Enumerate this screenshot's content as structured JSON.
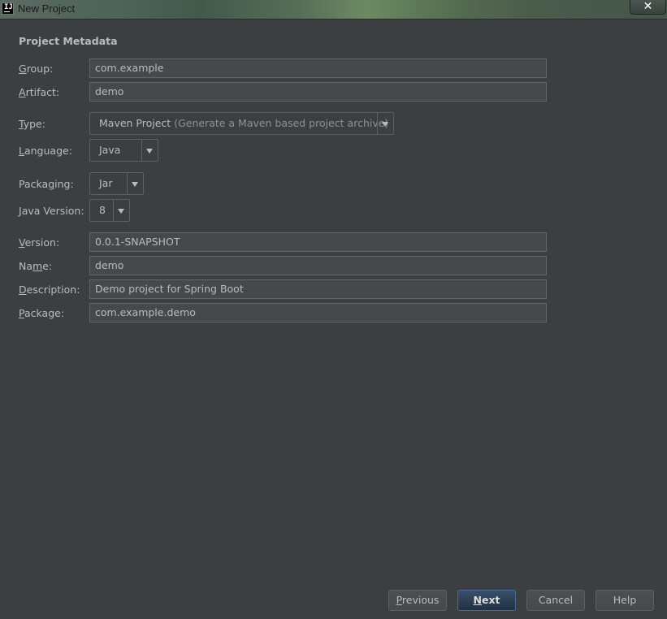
{
  "window": {
    "app_icon": "IJ",
    "title": "New Project",
    "close_glyph": "✕"
  },
  "section_title": "Project Metadata",
  "fields": {
    "group": {
      "label_mnemonic": "G",
      "label_rest": "roup:",
      "value": "com.example"
    },
    "artifact": {
      "label_mnemonic": "A",
      "label_rest": "rtifact:",
      "value": "demo"
    },
    "version": {
      "label_mnemonic": "V",
      "label_rest": "ersion:",
      "value": "0.0.1-SNAPSHOT"
    },
    "name": {
      "label_pre": "Na",
      "label_mnemonic": "m",
      "label_rest": "e:",
      "value": "demo"
    },
    "description": {
      "label_mnemonic": "D",
      "label_rest": "escription:",
      "value": "Demo project for Spring Boot"
    },
    "package": {
      "label_mnemonic": "P",
      "label_rest": "ackage:",
      "value": "com.example.demo"
    }
  },
  "selects": {
    "type": {
      "label_mnemonic": "T",
      "label_rest": "ype:",
      "value": "Maven Project",
      "detail": "(Generate a Maven based project archive)"
    },
    "language": {
      "label_mnemonic": "L",
      "label_rest": "anguage:",
      "value": "Java"
    },
    "packaging": {
      "label_pre": "Packa",
      "label_mnemonic": "g",
      "label_rest": "ing:",
      "value": "Jar"
    },
    "java_version": {
      "label_mnemonic": "J",
      "label_rest": "ava Version:",
      "value": "8"
    }
  },
  "buttons": {
    "previous": {
      "mnemonic": "P",
      "rest": "revious"
    },
    "next": {
      "mnemonic": "N",
      "rest": "ext"
    },
    "cancel": "Cancel",
    "help": "Help"
  }
}
